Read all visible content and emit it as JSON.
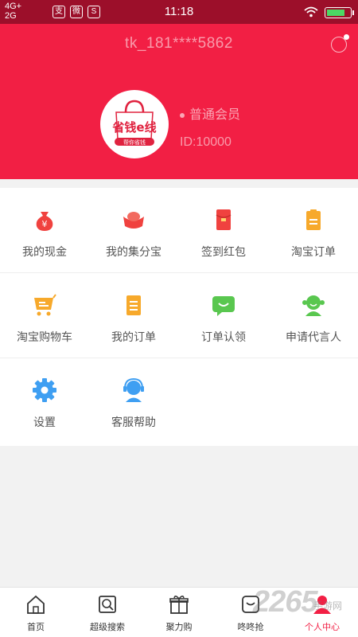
{
  "status_bar": {
    "network_top": "4G+",
    "network_bottom": "2G",
    "time": "11:18",
    "apps": [
      "支",
      "微",
      "S"
    ]
  },
  "profile": {
    "phone": "tk_181****5862",
    "member_level": "普通会员",
    "user_id": "ID:10000",
    "logo_text": "省钱e线",
    "logo_tagline": "帮你省钱"
  },
  "menu": {
    "items": [
      {
        "label": "我的现金",
        "icon": "money-bag-icon"
      },
      {
        "label": "我的集分宝",
        "icon": "ingot-icon"
      },
      {
        "label": "签到红包",
        "icon": "red-envelope-icon"
      },
      {
        "label": "淘宝订单",
        "icon": "clipboard-icon"
      },
      {
        "label": "淘宝购物车",
        "icon": "shopping-cart-icon"
      },
      {
        "label": "我的订单",
        "icon": "order-list-icon"
      },
      {
        "label": "订单认领",
        "icon": "chat-bubble-icon"
      },
      {
        "label": "申请代言人",
        "icon": "spokesperson-icon"
      },
      {
        "label": "设置",
        "icon": "gear-icon"
      },
      {
        "label": "客服帮助",
        "icon": "headset-icon"
      }
    ]
  },
  "nav": {
    "items": [
      {
        "label": "首页",
        "icon": "home-icon"
      },
      {
        "label": "超级搜索",
        "icon": "search-icon"
      },
      {
        "label": "聚力购",
        "icon": "gift-icon"
      },
      {
        "label": "咚咚抢",
        "icon": "flash-sale-icon"
      },
      {
        "label": "个人中心",
        "icon": "user-icon"
      }
    ],
    "active_index": 4
  },
  "watermark": {
    "text": "2265",
    "sub": "手游网"
  },
  "colors": {
    "brand_red": "#f21f44",
    "status_bar": "#9c0f2a"
  }
}
